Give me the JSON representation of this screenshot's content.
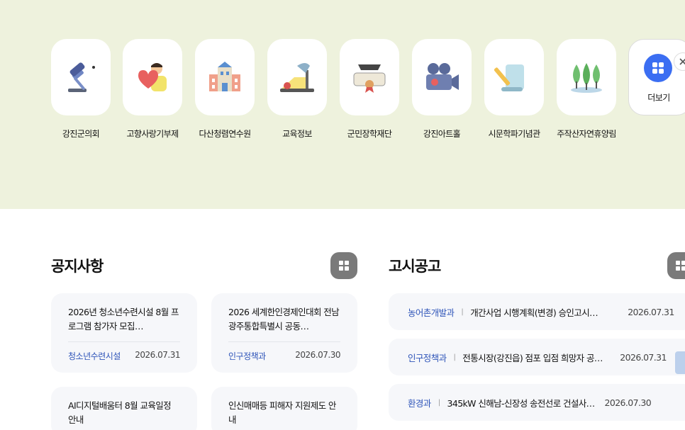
{
  "quick_links": {
    "items": [
      {
        "label": "강진군의회",
        "icon": "gavel-icon"
      },
      {
        "label": "고향사랑기부제",
        "icon": "heart-person-icon"
      },
      {
        "label": "다산청렴연수원",
        "icon": "building-icon"
      },
      {
        "label": "교육정보",
        "icon": "desk-lamp-icon"
      },
      {
        "label": "군민장학재단",
        "icon": "graduation-diploma-icon"
      },
      {
        "label": "강진아트홀",
        "icon": "film-camera-icon"
      },
      {
        "label": "시문학파기념관",
        "icon": "pencil-scroll-icon"
      },
      {
        "label": "주작산자연휴양림",
        "icon": "trees-icon"
      }
    ],
    "more_label": "더보기"
  },
  "notices": {
    "title": "공지사항",
    "items": [
      {
        "title": "2026년 청소년수련시설 8월 프로그램 참가자 모집…",
        "dept": "청소년수련시설",
        "date": "2026.07.31"
      },
      {
        "title": "2026 세계한인경제인대회 전남광주통합특별시 공동…",
        "dept": "인구정책과",
        "date": "2026.07.30"
      },
      {
        "title": "AI디지털배움터 8월 교육일정 안내",
        "dept": "",
        "date": ""
      },
      {
        "title": "인신매매등 피해자 지원제도 안내",
        "dept": "",
        "date": ""
      }
    ]
  },
  "announcements": {
    "title": "고시공고",
    "items": [
      {
        "dept": "농어촌개발과",
        "title": "개간사업 시행계획(변경) 승인고시…",
        "date": "2026.07.31"
      },
      {
        "dept": "인구정책과",
        "title": "전통시장(강진읍) 점포 입점 희망자 공…",
        "date": "2026.07.31"
      },
      {
        "dept": "환경과",
        "title": "345kW 신해남-신장성 송전선로 건설사…",
        "date": "2026.07.30"
      }
    ]
  },
  "colors": {
    "band": "#eef2dd",
    "accent": "#3b6ef2",
    "dept": "#2f55b9"
  }
}
